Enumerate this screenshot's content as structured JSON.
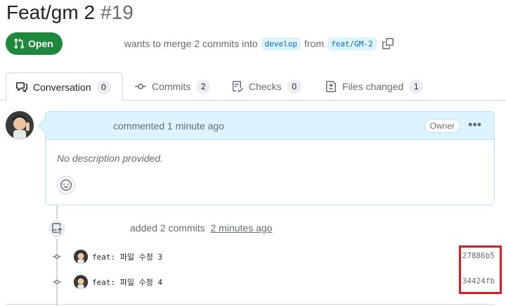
{
  "pr": {
    "title": "Feat/gm 2",
    "number": "#19",
    "state": "Open",
    "merge_text": "wants to merge 2 commits into",
    "base_branch": "develop",
    "from_text": "from",
    "head_branch": "feat/GM-2"
  },
  "tabs": [
    {
      "label": "Conversation",
      "count": "0",
      "icon": "comment-discussion-icon",
      "active": true
    },
    {
      "label": "Commits",
      "count": "2",
      "icon": "git-commit-icon"
    },
    {
      "label": "Checks",
      "count": "0",
      "icon": "checklist-icon"
    },
    {
      "label": "Files changed",
      "count": "1",
      "icon": "file-diff-icon"
    }
  ],
  "comment": {
    "meta": "commented 1 minute ago",
    "badge": "Owner",
    "body": "No description provided."
  },
  "timeline": {
    "push_text": "added 2 commits",
    "push_time": "2 minutes ago",
    "commits": [
      {
        "message": "feat: 파일 수정 3",
        "sha": "27886b5"
      },
      {
        "message": "feat: 파일 수정 4",
        "sha": "34424fb"
      }
    ]
  },
  "colors": {
    "open_green": "#1f883d",
    "link_blue": "#0969da",
    "highlight_red": "#e01b24"
  }
}
